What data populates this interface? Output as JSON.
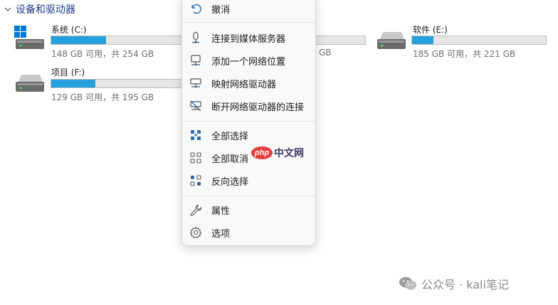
{
  "section": {
    "title": "设备和驱动器"
  },
  "drives": [
    {
      "name": "系统 (C:)",
      "sizes": "148 GB 可用，共 254 GB",
      "used_fraction": 0.42,
      "icon": "windows-drive-icon"
    },
    {
      "name": "",
      "sizes": "GB",
      "used_fraction": 0.6,
      "icon": "drive-icon"
    },
    {
      "name": "软件 (E:)",
      "sizes": "185 GB 可用，共 221 GB",
      "used_fraction": 0.16,
      "icon": "drive-icon"
    },
    {
      "name": "项目 (F:)",
      "sizes": "129 GB 可用，共 195 GB",
      "used_fraction": 0.34,
      "icon": "drive-icon"
    }
  ],
  "menu": {
    "items": [
      {
        "label": "撤消",
        "icon": "undo-icon"
      },
      {
        "label": "连接到媒体服务器",
        "icon": "media-server-icon"
      },
      {
        "label": "添加一个网络位置",
        "icon": "network-location-icon"
      },
      {
        "label": "映射网络驱动器",
        "icon": "map-network-drive-icon"
      },
      {
        "label": "断开网络驱动器的连接",
        "icon": "disconnect-network-drive-icon"
      },
      {
        "label": "全部选择",
        "icon": "select-all-icon"
      },
      {
        "label": "全部取消",
        "icon": "select-none-icon"
      },
      {
        "label": "反向选择",
        "icon": "invert-selection-icon"
      },
      {
        "label": "属性",
        "icon": "wrench-icon"
      },
      {
        "label": "选项",
        "icon": "gear-icon"
      }
    ]
  },
  "watermarks": {
    "php_badge": "php",
    "php_site": "中文网",
    "wechat": "公众号 · kali笔记"
  },
  "colors": {
    "accent": "#26a0da",
    "header_text": "#1a3a8a",
    "windows_blue": "#0078d4"
  }
}
